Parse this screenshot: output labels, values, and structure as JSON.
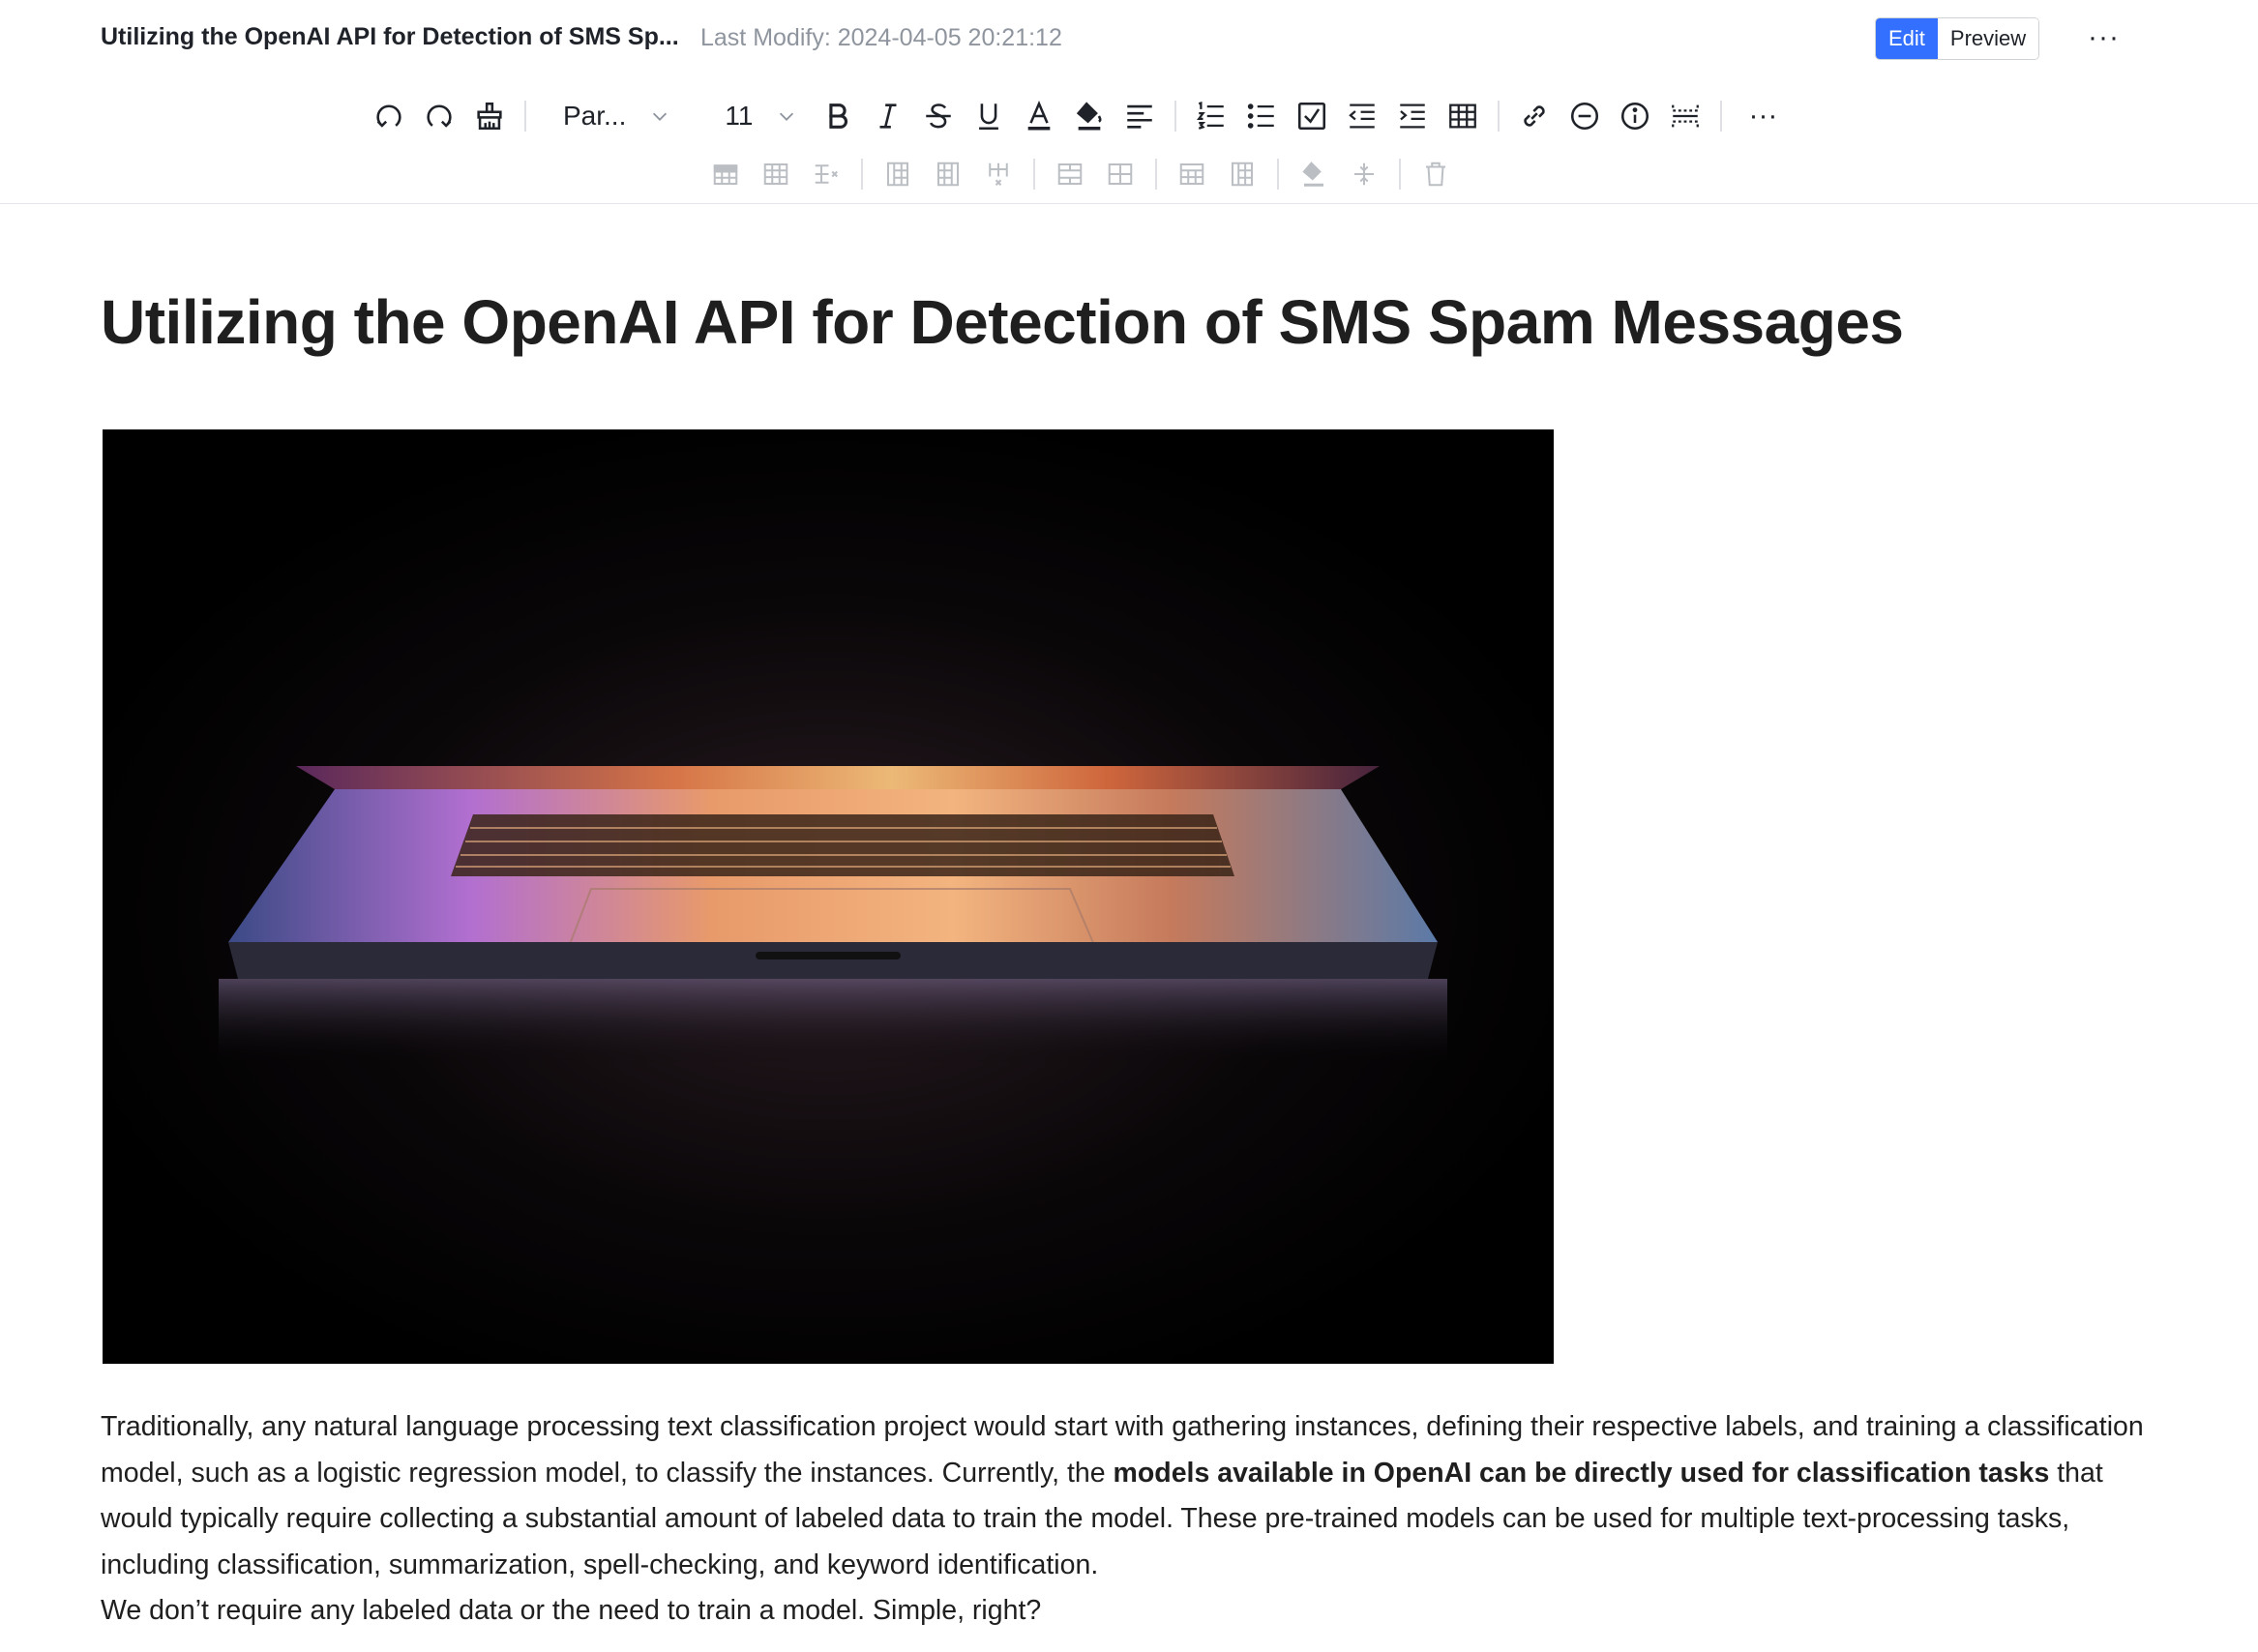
{
  "header": {
    "doc_title": "Utilizing the OpenAI API for Detection of SMS Sp...",
    "last_modify": "Last Modify: 2024-04-05 20:21:12",
    "mode_edit": "Edit",
    "mode_preview": "Preview",
    "more": "···"
  },
  "toolbar": {
    "paragraph_style": "Par...",
    "font_size": "11",
    "more": "···"
  },
  "article": {
    "title": "Utilizing the OpenAI API for Detection of SMS Spam Messages",
    "para1_a": "Traditionally, any natural language processing text classification project would start with gathering instances, defining their respective labels, and training a classification model, such as a logistic regression model, to classify the instances. Currently, the ",
    "para1_bold": "models available in OpenAI can be directly used for classification tasks",
    "para1_b": " that would typically require collecting a substantial amount of labeled data to train the model. These pre-trained models can be used for multiple text-processing tasks, including classification, summarization, spell-checking, and keyword identification.",
    "para2": "We don’t require any labeled data or the need to train a model. Simple, right?"
  },
  "colors": {
    "accent": "#3370ff",
    "text": "#1f1f1f",
    "muted": "#8f959e",
    "icon": "#1f2329",
    "icon_disabled": "#bbbfc4"
  }
}
